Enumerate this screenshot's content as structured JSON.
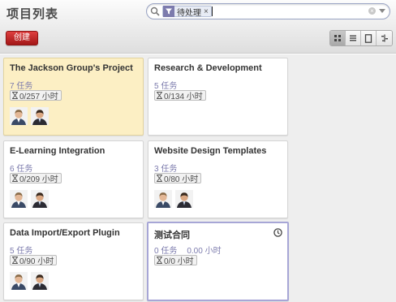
{
  "header": {
    "title": "项目列表",
    "create_label": "创建",
    "search": {
      "facet_label": "待处理",
      "facet_remove": "×",
      "clear": "×"
    },
    "views": [
      "kanban-icon",
      "list-icon",
      "form-icon",
      "gantt-icon"
    ],
    "active_view": "kanban"
  },
  "projects": [
    {
      "name": "The Jackson Group's Project",
      "tasks": "7 任务",
      "hours": "0/257 小时",
      "members": 2,
      "highlight": true
    },
    {
      "name": "Research & Development",
      "tasks": "5 任务",
      "hours": "0/134 小时",
      "members": 0
    },
    {
      "name": "E-Learning Integration",
      "tasks": "6 任务",
      "hours": "0/209 小时",
      "members": 2
    },
    {
      "name": "Website Design Templates",
      "tasks": "3 任务",
      "hours": "0/80 小时",
      "members": 2
    },
    {
      "name": "Data Import/Export Plugin",
      "tasks": "5 任务",
      "hours": "0/90 小时",
      "members": 2
    },
    {
      "name": "测试合同",
      "tasks": "0 任务",
      "planned": "0.00 小时",
      "hours": "0/0 小时",
      "members": 0,
      "selected": true
    }
  ],
  "colors": {
    "accent": "#7c7bad",
    "create_button": "#c42424",
    "highlight_card": "#fcefc4",
    "board_bg": "#eeeeee"
  }
}
